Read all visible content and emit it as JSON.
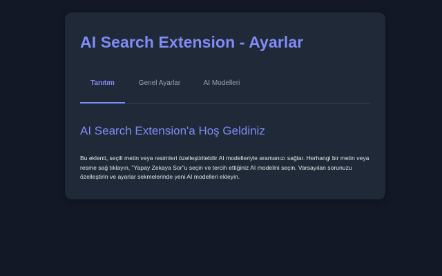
{
  "page": {
    "title": "AI Search Extension - Ayarlar"
  },
  "tabs": [
    {
      "label": "Tanıtım",
      "active": true
    },
    {
      "label": "Genel Ayarlar",
      "active": false
    },
    {
      "label": "AI Modelleri",
      "active": false
    }
  ],
  "intro": {
    "heading": "AI Search Extension'a Hoş Geldiniz",
    "description": "Bu eklenti, seçili metin veya resimleri özelleştirilebilir AI modelleriyle aramanızı sağlar. Herhangi bir metin veya resme sağ tıklayın, \"Yapay Zekaya Sor\"u seçin ve tercih ettiğiniz AI modelini seçin. Varsayılan sorunuzu özelleştirin ve ayarlar sekmelerinde yeni AI modelleri ekleyin."
  },
  "colors": {
    "background": "#121826",
    "card": "#1f2937",
    "accent": "#818cf8",
    "muted_text": "#9ca3af",
    "body_text": "#e5e7eb"
  }
}
